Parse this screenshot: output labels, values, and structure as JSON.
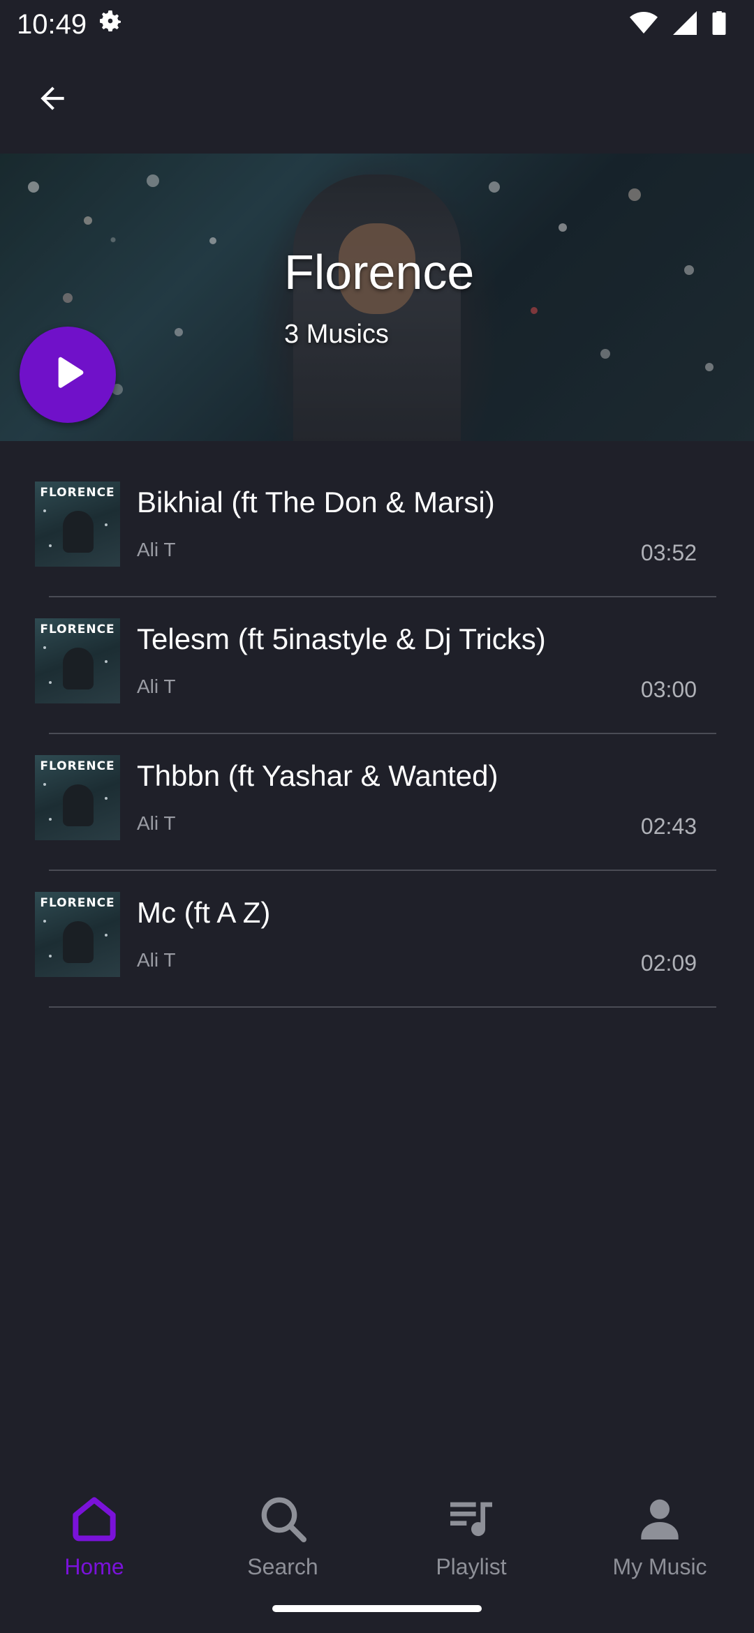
{
  "status_bar": {
    "time": "10:49"
  },
  "app_bar": {
    "back_icon": "arrow-left-icon"
  },
  "hero": {
    "title": "Florence",
    "subtitle": "3 Musics",
    "play_icon": "play-icon"
  },
  "tracks": [
    {
      "title": "Bikhial (ft The Don & Marsi)",
      "artist": "Ali T",
      "duration": "03:52",
      "cover_text": "FLORENCE"
    },
    {
      "title": "Telesm (ft 5inastyle & Dj Tricks)",
      "artist": "Ali T",
      "duration": "03:00",
      "cover_text": "FLORENCE"
    },
    {
      "title": "Thbbn (ft Yashar & Wanted)",
      "artist": "Ali T",
      "duration": "02:43",
      "cover_text": "FLORENCE"
    },
    {
      "title": "Mc (ft A Z)",
      "artist": "Ali T",
      "duration": "02:09",
      "cover_text": "FLORENCE"
    }
  ],
  "bottom_nav": [
    {
      "label": "Home",
      "icon": "home-icon",
      "active": true
    },
    {
      "label": "Search",
      "icon": "search-icon",
      "active": false
    },
    {
      "label": "Playlist",
      "icon": "playlist-icon",
      "active": false
    },
    {
      "label": "My Music",
      "icon": "person-icon",
      "active": false
    }
  ],
  "colors": {
    "accent": "#7011c9",
    "background": "#1f2029",
    "divider": "#4a4c55",
    "inactive": "#8e9098"
  }
}
